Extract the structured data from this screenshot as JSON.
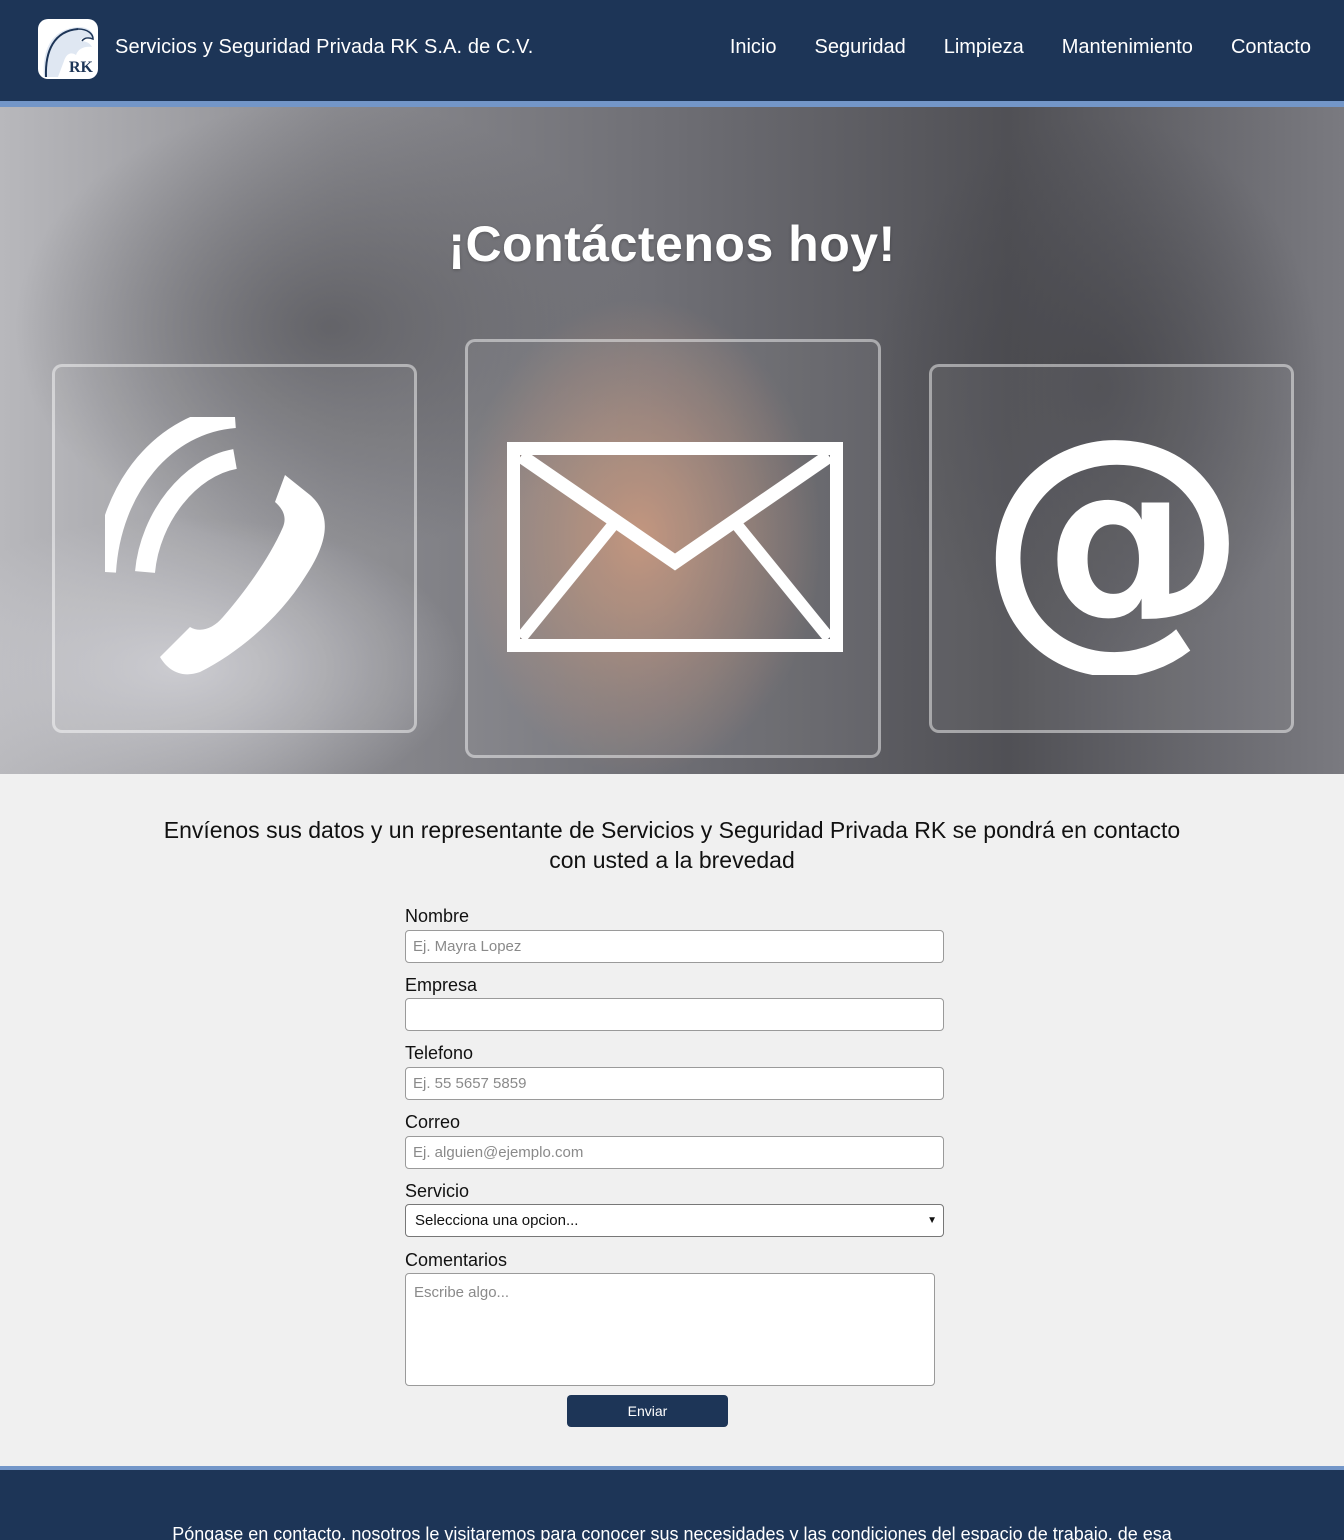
{
  "header": {
    "logo_text": "RK",
    "brand_name": "Servicios y Seguridad Privada RK S.A. de C.V.",
    "nav": [
      "Inicio",
      "Seguridad",
      "Limpieza",
      "Mantenimiento",
      "Contacto"
    ],
    "background_color": "#1d3557",
    "stripe_color": "#7396c8"
  },
  "hero": {
    "title": "¡Contáctenos hoy!",
    "icons": [
      "phone-icon",
      "envelope-icon",
      "at-sign-icon"
    ]
  },
  "form": {
    "intro": "Envíenos sus datos y un representante de Servicios y Seguridad Privada RK se pondrá en contacto con usted a la brevedad",
    "nombre_label": "Nombre",
    "nombre_placeholder": "Ej. Mayra Lopez",
    "empresa_label": "Empresa",
    "empresa_placeholder": "",
    "telefono_label": "Telefono",
    "telefono_placeholder": "Ej. 55 5657 5859",
    "correo_label": "Correo",
    "correo_placeholder": "Ej. alguien@ejemplo.com",
    "servicio_label": "Servicio",
    "servicio_selected": "Selecciona una opcion...",
    "comentarios_label": "Comentarios",
    "comentarios_placeholder": "Escribe algo...",
    "submit_label": "Enviar"
  },
  "footer": {
    "text": "Póngase en contacto, nosotros le visitaremos para conocer sus necesidades y las condiciones del espacio de trabajo, de esa"
  }
}
